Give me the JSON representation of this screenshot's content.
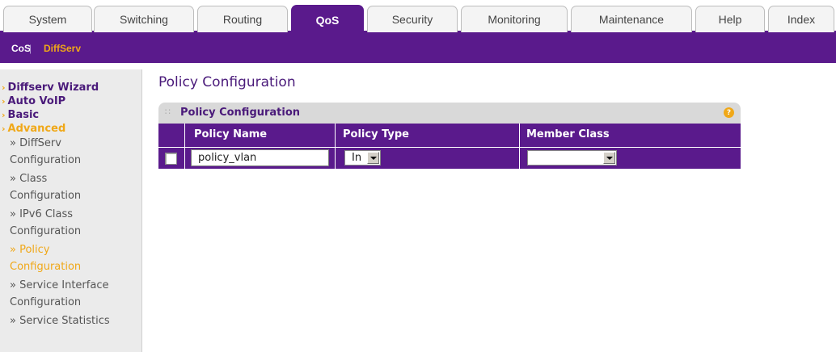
{
  "tabs": [
    "System",
    "Switching",
    "Routing",
    "QoS",
    "Security",
    "Monitoring",
    "Maintenance",
    "Help",
    "Index"
  ],
  "active_tab": "QoS",
  "subnav": {
    "cos": "CoS",
    "separator": "|",
    "diffserv": "DiffServ"
  },
  "sidebar": {
    "items": [
      {
        "label": "Diffserv Wizard"
      },
      {
        "label": "Auto VoIP"
      },
      {
        "label": "Basic"
      },
      {
        "label": "Advanced"
      }
    ],
    "sub_items": [
      {
        "line1": "» DiffServ",
        "line2": "Configuration"
      },
      {
        "line1": "» Class",
        "line2": "Configuration"
      },
      {
        "line1": "» IPv6 Class",
        "line2": "Configuration"
      },
      {
        "line1": "» Policy",
        "line2": "Configuration"
      },
      {
        "line1": "» Service Interface",
        "line2": "Configuration"
      },
      {
        "line1": "» Service Statistics",
        "line2": ""
      }
    ]
  },
  "main": {
    "page_title": "Policy Configuration",
    "panel_title": "Policy Configuration",
    "help_icon": "?",
    "columns": [
      "Policy Name",
      "Policy Type",
      "Member Class"
    ],
    "row": {
      "policy_name": "policy_vlan",
      "policy_type": "In",
      "member_class": ""
    }
  },
  "colors": {
    "brand_purple": "#5a1a8c",
    "accent_orange": "#f0a818"
  }
}
